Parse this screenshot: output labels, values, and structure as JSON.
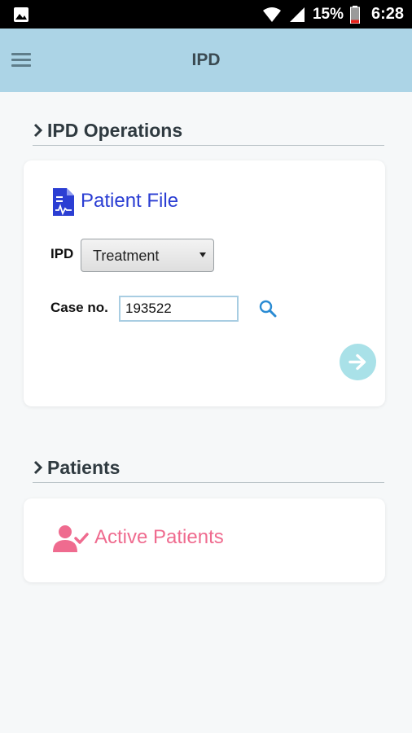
{
  "status_bar": {
    "battery_percent": "15%",
    "time": "6:28",
    "icons": [
      "image-icon",
      "wifi-icon",
      "signal-icon",
      "battery-icon"
    ]
  },
  "app_bar": {
    "title": "IPD",
    "menu_icon": "hamburger-menu-icon"
  },
  "ipd_operations": {
    "heading": "IPD Operations",
    "card": {
      "title": "Patient File",
      "ipd_label": "IPD",
      "ipd_select_value": "Treatment",
      "case_label": "Case no.",
      "case_value": "193522",
      "search_icon": "search-icon",
      "go_icon": "arrow-right-icon"
    }
  },
  "patients": {
    "heading": "Patients",
    "card": {
      "title": "Active Patients",
      "icon": "user-check-icon"
    }
  },
  "colors": {
    "app_bar_bg": "#acd4e6",
    "patient_file_accent": "#2b3ed3",
    "active_patients_accent": "#ef6b8f",
    "go_button_bg": "#a9e1e8"
  }
}
